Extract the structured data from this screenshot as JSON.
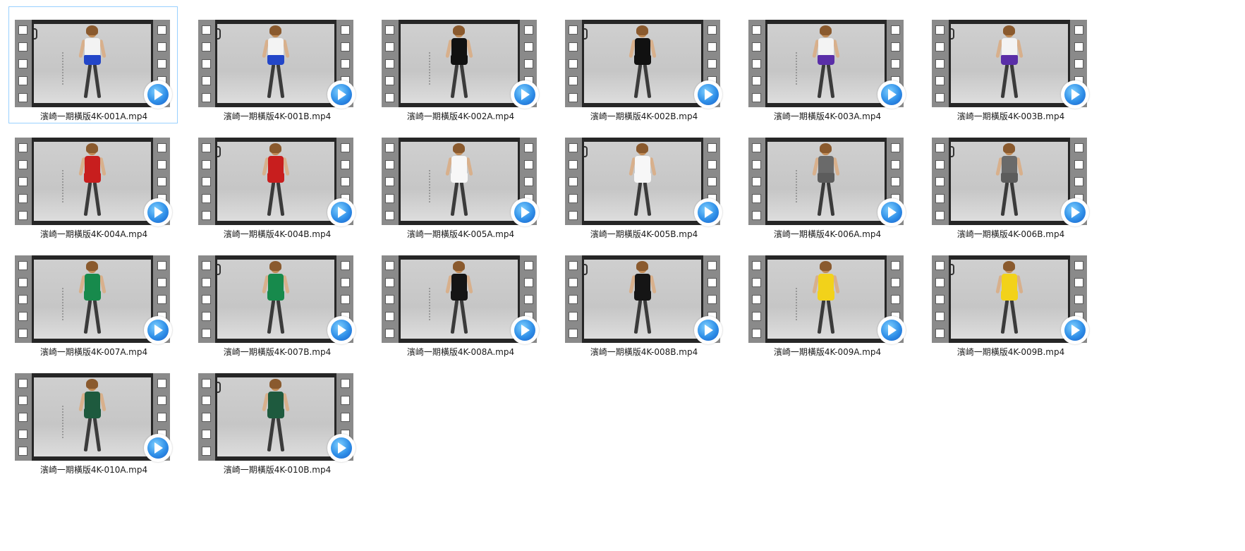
{
  "files": [
    {
      "name": "濱崎一期橫版4K-001A.mp4",
      "outfit": "#2346c8",
      "top": "#f3f3f3",
      "selected": true
    },
    {
      "name": "濱崎一期橫版4K-001B.mp4",
      "outfit": "#2346c8",
      "top": "#f3f3f3",
      "selected": false
    },
    {
      "name": "濱崎一期橫版4K-002A.mp4",
      "outfit": "#111111",
      "top": "#111111",
      "selected": false
    },
    {
      "name": "濱崎一期橫版4K-002B.mp4",
      "outfit": "#111111",
      "top": "#111111",
      "selected": false
    },
    {
      "name": "濱崎一期橫版4K-003A.mp4",
      "outfit": "#5a2ea8",
      "top": "#f3f3f3",
      "selected": false
    },
    {
      "name": "濱崎一期橫版4K-003B.mp4",
      "outfit": "#5a2ea8",
      "top": "#f3f3f3",
      "selected": false
    },
    {
      "name": "濱崎一期橫版4K-004A.mp4",
      "outfit": "#c81e1e",
      "top": "#c81e1e",
      "selected": false
    },
    {
      "name": "濱崎一期橫版4K-004B.mp4",
      "outfit": "#c81e1e",
      "top": "#c81e1e",
      "selected": false
    },
    {
      "name": "濱崎一期橫版4K-005A.mp4",
      "outfit": "#f7f7f7",
      "top": "#f7f7f7",
      "selected": false
    },
    {
      "name": "濱崎一期橫版4K-005B.mp4",
      "outfit": "#f7f7f7",
      "top": "#f7f7f7",
      "selected": false
    },
    {
      "name": "濱崎一期橫版4K-006A.mp4",
      "outfit": "#5c5c5c",
      "top": "#6a6a6a",
      "selected": false
    },
    {
      "name": "濱崎一期橫版4K-006B.mp4",
      "outfit": "#5c5c5c",
      "top": "#6a6a6a",
      "selected": false
    },
    {
      "name": "濱崎一期橫版4K-007A.mp4",
      "outfit": "#178a4c",
      "top": "#178a4c",
      "selected": false
    },
    {
      "name": "濱崎一期橫版4K-007B.mp4",
      "outfit": "#178a4c",
      "top": "#178a4c",
      "selected": false
    },
    {
      "name": "濱崎一期橫版4K-008A.mp4",
      "outfit": "#151515",
      "top": "#151515",
      "selected": false
    },
    {
      "name": "濱崎一期橫版4K-008B.mp4",
      "outfit": "#151515",
      "top": "#151515",
      "selected": false
    },
    {
      "name": "濱崎一期橫版4K-009A.mp4",
      "outfit": "#f2d21a",
      "top": "#f2d21a",
      "selected": false
    },
    {
      "name": "濱崎一期橫版4K-009B.mp4",
      "outfit": "#f2d21a",
      "top": "#f2d21a",
      "selected": false
    },
    {
      "name": "濱崎一期橫版4K-010A.mp4",
      "outfit": "#1e5a3e",
      "top": "#1e5a3e",
      "selected": false
    },
    {
      "name": "濱崎一期橫版4K-010B.mp4",
      "outfit": "#1e5a3e",
      "top": "#1e5a3e",
      "selected": false
    }
  ],
  "icons": {
    "file_type": "video-player-icon",
    "thumbnail_frame": "filmstrip-icon"
  }
}
